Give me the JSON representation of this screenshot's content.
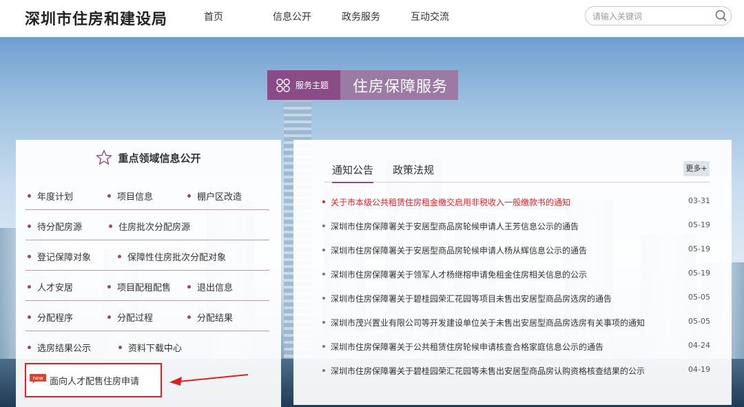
{
  "header": {
    "logo": "深圳市住房和建设局",
    "nav": [
      "首页",
      "信息公开",
      "政务服务",
      "互动交流"
    ],
    "search_placeholder": "请输入关键词"
  },
  "theme": {
    "tag": "服务主题",
    "title": "住房保障服务"
  },
  "left_panel": {
    "title": "重点领域信息公开",
    "rows": [
      [
        "年度计划",
        "项目信息",
        "棚户区改造"
      ],
      [
        "待分配房源",
        "住房批次分配房源"
      ],
      [
        "登记保障对象",
        "保障性住房批次分配对象"
      ],
      [
        "人才安居",
        "项目配租配售",
        "退出信息"
      ],
      [
        "分配程序",
        "分配过程",
        "分配结果"
      ],
      [
        "选房结果公示",
        "资料下载中心"
      ]
    ],
    "special_badge": "new",
    "special_link": "面向人才配售住房申请"
  },
  "right_panel": {
    "tabs": [
      "通知公告",
      "政策法规"
    ],
    "more": "更多+",
    "news": [
      {
        "title": "关于市本级公共租赁住房租金缴交启用非税收入一般缴款书的通知",
        "date": "03-31",
        "hot": true
      },
      {
        "title": "深圳市住房保障署关于安居型商品房轮候申请人王芳信息公示的通告",
        "date": "05-19",
        "hot": false
      },
      {
        "title": "深圳市住房保障署关于安居型商品房轮候申请人杨从辉信息公示的通告",
        "date": "05-19",
        "hot": false
      },
      {
        "title": "深圳市住房保障署关于领军人才杨继榕申请免租金住房相关信息的公示",
        "date": "05-19",
        "hot": false
      },
      {
        "title": "深圳市住房保障署关于碧桂园荣汇花园等项目未售出安居型商品房选房的通告",
        "date": "05-05",
        "hot": false
      },
      {
        "title": "深圳市茂兴置业有限公司等开发建设单位关于未售出安居型商品房选房有关事项的通知",
        "date": "05-05",
        "hot": false
      },
      {
        "title": "深圳市住房保障署关于公共租赁住房轮候申请核查合格家庭信息公示的通告",
        "date": "04-24",
        "hot": false
      },
      {
        "title": "深圳市住房保障署关于碧桂园荣汇花园等未售出安居型商品房认购资格核查结果的公示",
        "date": "04-19",
        "hot": false
      }
    ]
  },
  "colors": {
    "accent": "#8a4c86",
    "theme_title_bg": "#9b7aa3",
    "hot_news": "#d6262a",
    "highlight_border": "#e02020"
  }
}
